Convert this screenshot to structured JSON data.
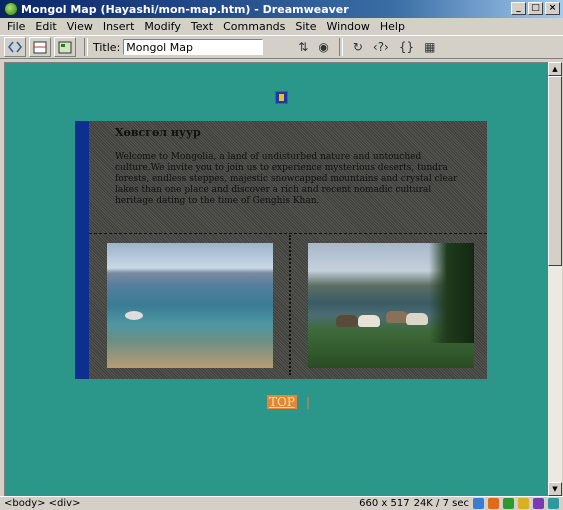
{
  "window": {
    "title": "Mongol Map (Hayashi/mon-map.htm) - Dreamweaver",
    "min_label": "_",
    "max_label": "□",
    "close_label": "×"
  },
  "menu": {
    "items": [
      "File",
      "Edit",
      "View",
      "Insert",
      "Modify",
      "Text",
      "Commands",
      "Site",
      "Window",
      "Help"
    ]
  },
  "toolbar": {
    "title_label": "Title:",
    "title_value": "Mongol Map"
  },
  "page": {
    "heading": "Хөвсгөл нуур",
    "body": "Welcome to Mongolia, a land of undisturbed nature and untouched culture.We invite you to join us to experience mysterious deserts, tundra forests, endless steppes, majestic snowcapped mountains and crystal clear lakes than one place and discover a rich and recent nomadic cultural heritage dating to the time of Genghis Khan.",
    "top_link": "TOP",
    "top_sep": "|"
  },
  "status": {
    "tags": "<body> <div>",
    "size": "660 x 517",
    "weight": "24K / 7 sec"
  },
  "colors": {
    "document_bg": "#2b968a",
    "panel_accent": "#0d2f8f",
    "link_bg": "#e0873a"
  }
}
